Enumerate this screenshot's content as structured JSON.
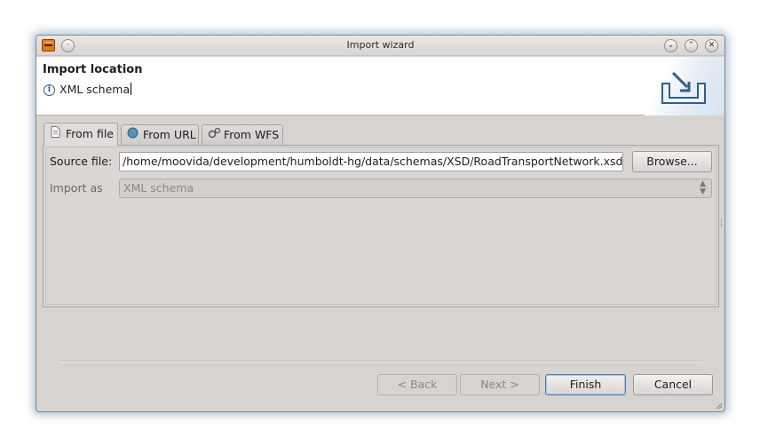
{
  "window": {
    "title": "Import wizard",
    "controls": {
      "minimize": "⌄",
      "maximize": "⌃",
      "close": "✕",
      "menu": "·"
    }
  },
  "header": {
    "title": "Import location",
    "message": "XML schema"
  },
  "tabs": [
    {
      "label": "From file",
      "icon": "file-icon",
      "active": true
    },
    {
      "label": "From URL",
      "icon": "globe-icon",
      "active": false
    },
    {
      "label": "From WFS",
      "icon": "gears-icon",
      "active": false
    }
  ],
  "form": {
    "source_label": "Source file:",
    "source_value": "/home/moovida/development/humboldt-hg/data/schemas/XSD/RoadTransportNetwork.xsd",
    "browse_label": "Browse...",
    "import_as_label": "Import as",
    "import_as_value": "XML schema"
  },
  "footer": {
    "back_label": "< Back",
    "next_label": "Next >",
    "finish_label": "Finish",
    "cancel_label": "Cancel"
  },
  "colors": {
    "window_bg": "#d6d3d1",
    "header_bg": "#ffffff",
    "accent": "#4f7eb0",
    "glow": "#5078a0"
  }
}
